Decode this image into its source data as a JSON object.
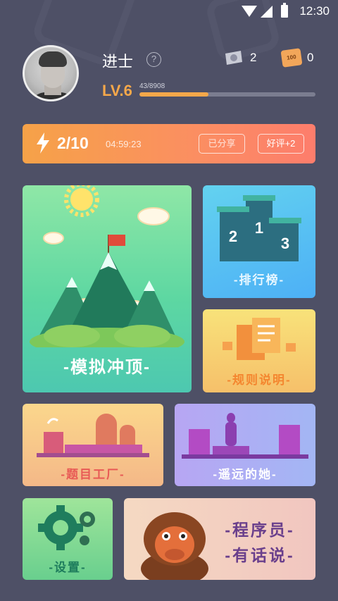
{
  "status_bar": {
    "time": "12:30"
  },
  "profile": {
    "name": "进士",
    "help_glyph": "?",
    "gems": "2",
    "tickets": "0",
    "ticket_label": "100",
    "level": "LV.6",
    "xp_text": "43/8908",
    "xp_progress": 0.39
  },
  "energy": {
    "count": "2/10",
    "timer": "04:59:23",
    "shared_label": "已分享",
    "review_label": "好评+2"
  },
  "cards": {
    "summit": "-模拟冲顶-",
    "rank": "-排行榜-",
    "rank_places": [
      "2",
      "1",
      "3"
    ],
    "rules": "-规则说明-",
    "factory": "-题目工厂-",
    "her": "-遥远的她-",
    "settings": "-设置-",
    "dev_line1": "-程序员-",
    "dev_line2": "-有话说-"
  },
  "colors": {
    "background": "#4e5066",
    "accent_orange": "#f6a84a",
    "energy_start": "#f6a248",
    "energy_end": "#fd7d6c"
  },
  "icons": [
    "wifi-icon",
    "signal-icon",
    "battery-icon",
    "help-icon",
    "gem-icon",
    "ticket-icon",
    "lightning-icon",
    "gear-icon"
  ]
}
